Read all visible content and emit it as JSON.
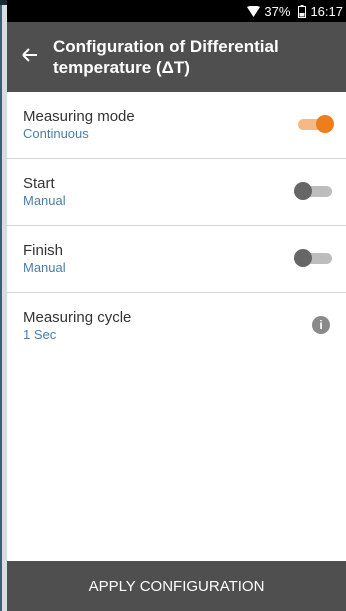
{
  "status_bar": {
    "battery_percent": "37%",
    "time": "16:17",
    "wifi_icon": "wifi-icon",
    "battery_icon": "battery-icon"
  },
  "app_bar": {
    "back_icon": "arrow-left-icon",
    "title": "Configuration of Differential temperature (ΔT)"
  },
  "settings": [
    {
      "label": "Measuring mode",
      "value": "Continuous",
      "control": "toggle",
      "on": true
    },
    {
      "label": "Start",
      "value": "Manual",
      "control": "toggle",
      "on": false
    },
    {
      "label": "Finish",
      "value": "Manual",
      "control": "toggle",
      "on": false
    },
    {
      "label": "Measuring cycle",
      "value": "1 Sec",
      "control": "info",
      "info_glyph": "i"
    }
  ],
  "footer": {
    "apply_label": "APPLY CONFIGURATION"
  },
  "colors": {
    "accent": "#f07d1b",
    "app_bar": "#4f4f4f",
    "value_text": "#4c7ea8"
  }
}
